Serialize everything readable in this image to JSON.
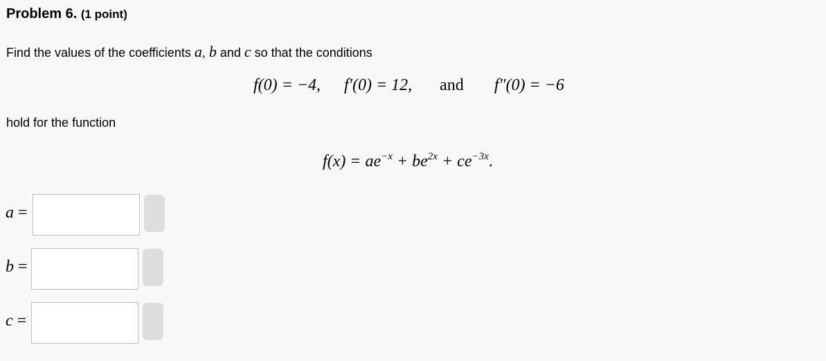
{
  "header": {
    "problem": "Problem 6.",
    "points": "(1 point)"
  },
  "prompt": {
    "text_before": "Find the values of the coefficients ",
    "var_a": "a",
    "comma": ", ",
    "var_b": "b",
    "and1": " and ",
    "var_c": "c",
    "text_after": " so that the conditions"
  },
  "conditions": {
    "c1": "f(0) = −4,",
    "c2": "f′(0) = 12,",
    "and": "and",
    "c3": "f″(0) = −6"
  },
  "hold_text": "hold for the function",
  "function": {
    "lhs": "f(x) = ",
    "t1": "ae",
    "e1": "−x",
    "t2": " + be",
    "e2": "2x",
    "t3": " + ce",
    "e3": "−3x",
    "end": "."
  },
  "answers": [
    {
      "var": "a",
      "eq": " =",
      "value": ""
    },
    {
      "var": "b",
      "eq": " =",
      "value": ""
    },
    {
      "var": "c",
      "eq": " =",
      "value": ""
    }
  ]
}
